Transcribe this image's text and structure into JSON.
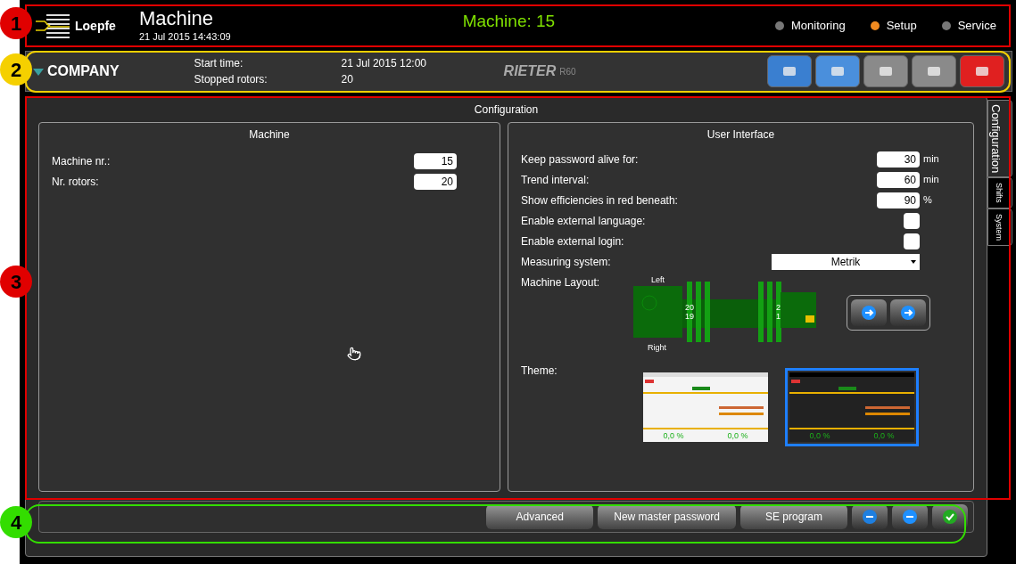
{
  "header": {
    "brand": "Loepfe",
    "title": "Machine",
    "datetime": "21 Jul 2015 14:43:09",
    "machine_label": "Machine: 15",
    "modes": [
      {
        "label": "Monitoring",
        "selected": false
      },
      {
        "label": "Setup",
        "selected": true
      },
      {
        "label": "Service",
        "selected": false
      }
    ]
  },
  "info_bar": {
    "company": "COMPANY",
    "fields": [
      {
        "label": "Start time:",
        "value": "21 Jul 2015 12:00"
      },
      {
        "label": "Stopped rotors:",
        "value": "20"
      }
    ],
    "machine_brand": "RIETER",
    "machine_model": "R60",
    "toolbar": [
      {
        "color": "#3a7fd0"
      },
      {
        "color": "#4a8fdc"
      },
      {
        "color": "#8a8a8a"
      },
      {
        "color": "#8a8a8a"
      },
      {
        "color": "#e02020"
      }
    ]
  },
  "configuration": {
    "title": "Configuration",
    "machine_panel": {
      "title": "Machine",
      "fields": [
        {
          "label": "Machine nr.:",
          "value": "15"
        },
        {
          "label": "Nr. rotors:",
          "value": "20"
        }
      ]
    },
    "ui_panel": {
      "title": "User Interface",
      "rows": [
        {
          "kind": "number",
          "label": "Keep password alive for:",
          "value": "30",
          "unit": "min"
        },
        {
          "kind": "number",
          "label": "Trend interval:",
          "value": "60",
          "unit": "min"
        },
        {
          "kind": "number",
          "label": "Show efficiencies in red beneath:",
          "value": "90",
          "unit": "%"
        },
        {
          "kind": "checkbox",
          "label": "Enable external language:",
          "checked": false
        },
        {
          "kind": "checkbox",
          "label": "Enable external login:",
          "checked": false
        },
        {
          "kind": "select",
          "label": "Measuring system:",
          "value": "Metrik"
        }
      ],
      "layout": {
        "label": "Machine Layout:",
        "left": "Left",
        "right": "Right",
        "left_numbers": [
          "20",
          "19"
        ],
        "right_numbers": [
          "2",
          "1"
        ]
      },
      "theme": {
        "label": "Theme:",
        "options": [
          {
            "kind": "light",
            "selected": false,
            "readings": [
              "0,0 %",
              "0,0 %"
            ]
          },
          {
            "kind": "dark",
            "selected": true,
            "readings": [
              "0,0 %",
              "0,0 %"
            ]
          }
        ]
      }
    },
    "buttons": [
      "Advanced",
      "New master password",
      "SE program"
    ]
  },
  "side_tabs": [
    {
      "label": "Configuration",
      "selected": true
    },
    {
      "label": "Shifts",
      "selected": false
    },
    {
      "label": "System",
      "selected": false
    }
  ],
  "callouts": [
    {
      "number": "1",
      "color": "#e00000"
    },
    {
      "number": "2",
      "color": "#f5d000"
    },
    {
      "number": "3",
      "color": "#e00000"
    },
    {
      "number": "4",
      "color": "#33dd00"
    }
  ]
}
